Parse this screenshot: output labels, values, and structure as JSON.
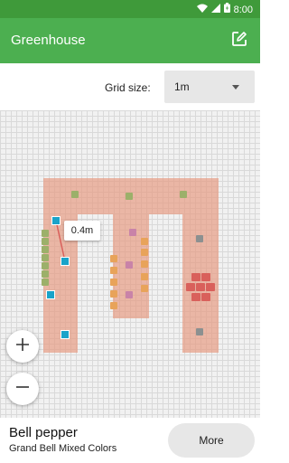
{
  "status_bar": {
    "time": "8:00"
  },
  "app_bar": {
    "title": "Greenhouse",
    "edit_icon": "pencil-square-icon"
  },
  "grid_size": {
    "label": "Grid size:",
    "value": "1m"
  },
  "canvas": {
    "measure_tooltip": "0.4m"
  },
  "zoom": {
    "in_icon": "plus-icon",
    "out_icon": "minus-icon"
  },
  "selected_plant": {
    "name": "Bell pepper",
    "variety": "Grand Bell Mixed Colors",
    "more_label": "More"
  },
  "colors": {
    "accent": "#4caf50",
    "status_bar": "#3f9a3a",
    "bed": "#e6967d",
    "plant_green": "#9cb06a",
    "plant_orange": "#e8a35a",
    "plant_purple": "#c983a8",
    "plant_red": "#d9605b",
    "plant_gray": "#8c9090",
    "selection": "#1aa3c9"
  }
}
